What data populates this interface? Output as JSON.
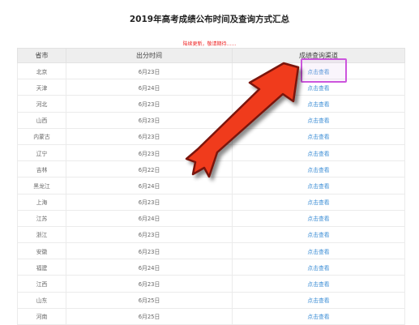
{
  "page": {
    "title": "2019年高考成绩公布时间及查询方式汇总",
    "notice": "陆续更新，敬请期待……"
  },
  "table": {
    "headers": [
      "省市",
      "出分时间",
      "成绩查询渠道"
    ],
    "rows": [
      {
        "province": "北京",
        "date": "6月23日",
        "link": "点击查看"
      },
      {
        "province": "天津",
        "date": "6月24日",
        "link": "点击查看"
      },
      {
        "province": "河北",
        "date": "6月23日",
        "link": "点击查看"
      },
      {
        "province": "山西",
        "date": "6月23日",
        "link": "点击查看"
      },
      {
        "province": "内蒙古",
        "date": "6月23日",
        "link": "点击查看"
      },
      {
        "province": "辽宁",
        "date": "6月23日",
        "link": "点击查看"
      },
      {
        "province": "吉林",
        "date": "6月22日",
        "link": "点击查看"
      },
      {
        "province": "黑龙江",
        "date": "6月24日",
        "link": "点击查看"
      },
      {
        "province": "上海",
        "date": "6月23日",
        "link": "点击查看"
      },
      {
        "province": "江苏",
        "date": "6月24日",
        "link": "点击查看"
      },
      {
        "province": "浙江",
        "date": "6月23日",
        "link": "点击查看"
      },
      {
        "province": "安徽",
        "date": "6月23日",
        "link": "点击查看"
      },
      {
        "province": "福建",
        "date": "6月24日",
        "link": "点击查看"
      },
      {
        "province": "江西",
        "date": "6月23日",
        "link": "点击查看"
      },
      {
        "province": "山东",
        "date": "6月25日",
        "link": "点击查看"
      },
      {
        "province": "河南",
        "date": "6月25日",
        "link": "点击查看"
      }
    ]
  },
  "colors": {
    "link": "#3f8fd6",
    "notice": "#ee2222",
    "arrow": "#f03a1c",
    "highlight": "#cc55dd"
  },
  "annotation": {
    "arrow_icon": "pointing-arrow-icon",
    "highlight_target": "first-row-query-link"
  }
}
